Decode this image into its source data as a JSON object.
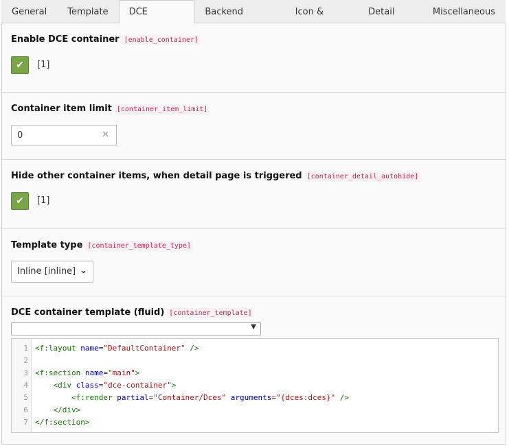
{
  "tabs": [
    "General",
    "Template",
    "DCE Container",
    "Backend Template",
    "Icon & Wizard",
    "Detail page",
    "Miscellaneous"
  ],
  "active_tab": 2,
  "fields": {
    "enable": {
      "label": "Enable DCE container",
      "key": "[enable_container]",
      "value": "[1]",
      "checked": true
    },
    "limit": {
      "label": "Container item limit",
      "key": "[container_item_limit]",
      "value": "0"
    },
    "autohide": {
      "label": "Hide other container items, when detail page is triggered",
      "key": "[container_detail_autohide]",
      "value": "[1]",
      "checked": true
    },
    "type": {
      "label": "Template type",
      "key": "[container_template_type]",
      "value": "Inline [inline]"
    },
    "template": {
      "label": "DCE container template (fluid)",
      "key": "[container_template]",
      "dropdown_value": ""
    }
  },
  "code_lines": [
    [
      [
        "tag",
        "<f:layout "
      ],
      [
        "attr",
        "name"
      ],
      [
        "txt",
        "="
      ],
      [
        "str",
        "\"DefaultContainer\""
      ],
      [
        "tag",
        " />"
      ]
    ],
    [],
    [
      [
        "tag",
        "<f:section "
      ],
      [
        "attr",
        "name"
      ],
      [
        "txt",
        "="
      ],
      [
        "str",
        "\"main\""
      ],
      [
        "tag",
        ">"
      ]
    ],
    [
      [
        "txt",
        "    "
      ],
      [
        "tag",
        "<div "
      ],
      [
        "attr",
        "class"
      ],
      [
        "txt",
        "="
      ],
      [
        "str",
        "\"dce-container\""
      ],
      [
        "tag",
        ">"
      ]
    ],
    [
      [
        "txt",
        "        "
      ],
      [
        "tag",
        "<f:render "
      ],
      [
        "attr",
        "partial"
      ],
      [
        "txt",
        "="
      ],
      [
        "str",
        "\"Container/Dces\""
      ],
      [
        "txt",
        " "
      ],
      [
        "attr",
        "arguments"
      ],
      [
        "txt",
        "="
      ],
      [
        "str",
        "\"{dces:dces}\""
      ],
      [
        "tag",
        " />"
      ]
    ],
    [
      [
        "txt",
        "    "
      ],
      [
        "tag",
        "</div>"
      ]
    ],
    [
      [
        "tag",
        "</f:section>"
      ]
    ]
  ]
}
